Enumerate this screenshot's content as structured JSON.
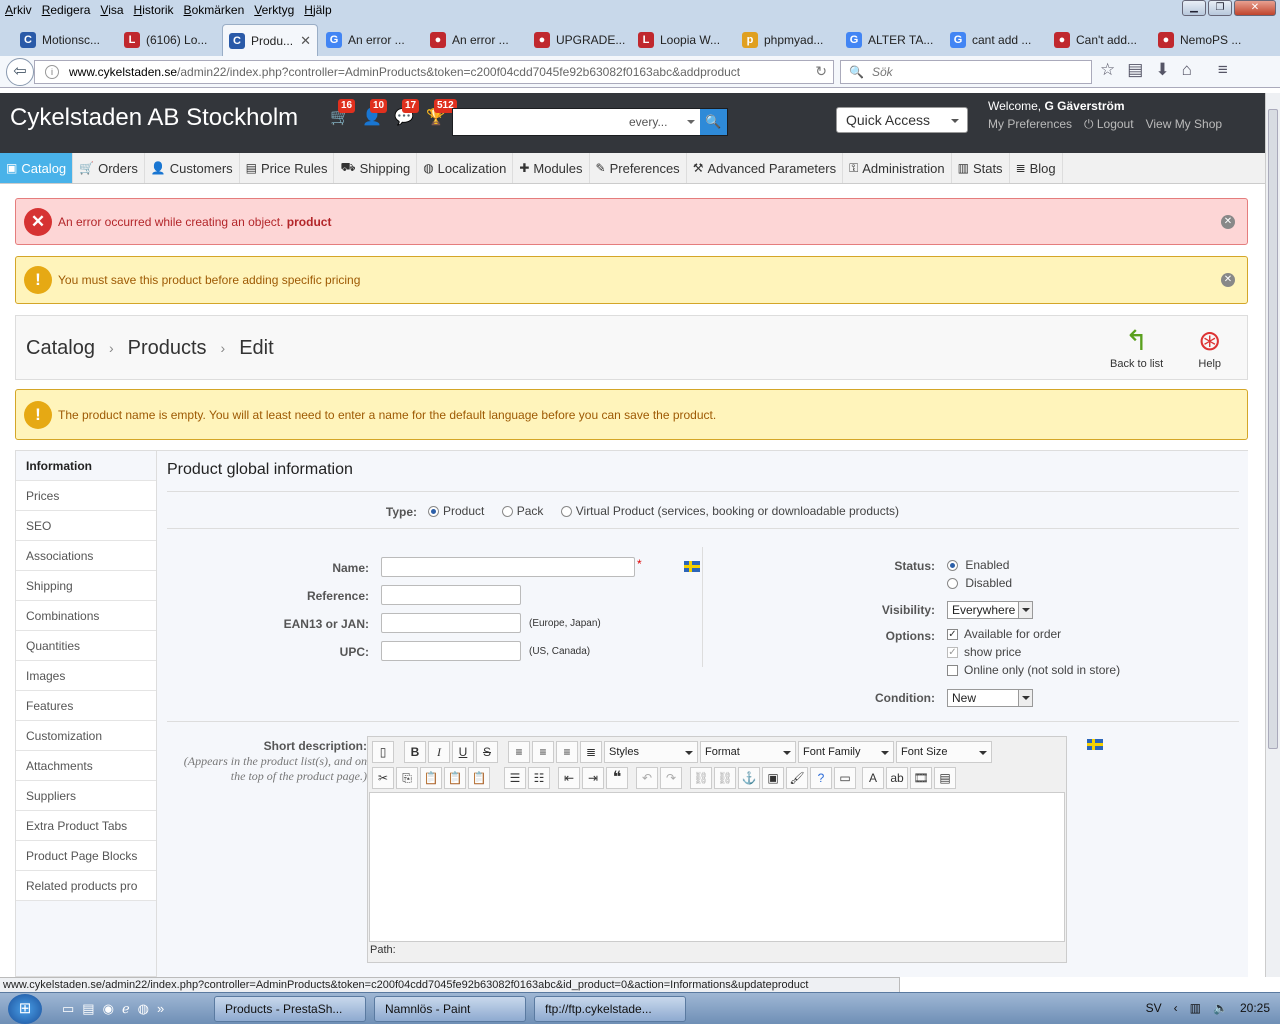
{
  "browser": {
    "menu": [
      "Arkiv",
      "Redigera",
      "Visa",
      "Historik",
      "Bokmärken",
      "Verktyg",
      "Hjälp"
    ],
    "tabs": [
      {
        "label": "Motionsc...",
        "icon": "C",
        "color": "#2a5aa8"
      },
      {
        "label": "(6106) Lo...",
        "icon": "L",
        "color": "#c0282e"
      },
      {
        "label": "Produ...",
        "icon": "C",
        "color": "#2a5aa8",
        "active": true
      },
      {
        "label": "An error ...",
        "icon": "G",
        "color": "#4285f4"
      },
      {
        "label": "An error ...",
        "icon": "●",
        "color": "#c0282e"
      },
      {
        "label": "UPGRADE...",
        "icon": "●",
        "color": "#c0282e"
      },
      {
        "label": "Loopia W...",
        "icon": "L",
        "color": "#c0282e"
      },
      {
        "label": "phpmyad...",
        "icon": "p",
        "color": "#e0a020"
      },
      {
        "label": "ALTER TA...",
        "icon": "G",
        "color": "#4285f4"
      },
      {
        "label": "cant add ...",
        "icon": "G",
        "color": "#4285f4"
      },
      {
        "label": "Can't add...",
        "icon": "●",
        "color": "#c0282e"
      },
      {
        "label": "NemoPS ...",
        "icon": "●",
        "color": "#c0282e"
      }
    ],
    "url_domain": "www.cykelstaden.se",
    "url_path": "/admin22/index.php?controller=AdminProducts&token=c200f04cdd7045fe92b63082f0163abc&addproduct",
    "search_placeholder": "Sök",
    "status_url": "www.cykelstaden.se/admin22/index.php?controller=AdminProducts&token=c200f04cdd7045fe92b63082f0163abc&id_product=0&action=Informations&updateproduct"
  },
  "header": {
    "brand": "Cykelstaden AB Stockholm",
    "badges": {
      "orders": "16",
      "customers": "10",
      "messages": "17",
      "trophy": "512"
    },
    "search_scope": "every...",
    "quick_access": "Quick Access",
    "welcome_prefix": "Welcome, ",
    "welcome_name": "G Gäverström",
    "my_preferences": "My Preferences",
    "logout": "Logout",
    "view_shop": "View My Shop"
  },
  "menu": [
    {
      "label": "Catalog",
      "icon": "▣"
    },
    {
      "label": "Orders",
      "icon": "🛒"
    },
    {
      "label": "Customers",
      "icon": "👤"
    },
    {
      "label": "Price Rules",
      "icon": "▤"
    },
    {
      "label": "Shipping",
      "icon": "⛟"
    },
    {
      "label": "Localization",
      "icon": "◍"
    },
    {
      "label": "Modules",
      "icon": "✚"
    },
    {
      "label": "Preferences",
      "icon": "✎"
    },
    {
      "label": "Advanced Parameters",
      "icon": "⚒"
    },
    {
      "label": "Administration",
      "icon": "⚿"
    },
    {
      "label": "Stats",
      "icon": "▥"
    },
    {
      "label": "Blog",
      "icon": "≣"
    }
  ],
  "alerts": {
    "error_text": "An error occurred while creating an object.",
    "error_bold": "product",
    "warn1": "You must save this product before adding specific pricing",
    "warn2": "The product name is empty. You will at least need to enter a name for the default language before you can save the product."
  },
  "toolbar": {
    "crumbs": [
      "Catalog",
      "Products",
      "Edit"
    ],
    "back": "Back to list",
    "help": "Help"
  },
  "sidetabs": [
    "Information",
    "Prices",
    "SEO",
    "Associations",
    "Shipping",
    "Combinations",
    "Quantities",
    "Images",
    "Features",
    "Customization",
    "Attachments",
    "Suppliers",
    "Extra Product Tabs",
    "Product Page Blocks",
    "Related products pro"
  ],
  "form": {
    "title": "Product global information",
    "type_label": "Type:",
    "type_options": [
      "Product",
      "Pack",
      "Virtual Product (services, booking or downloadable products)"
    ],
    "name_label": "Name:",
    "reference_label": "Reference:",
    "ean_label": "EAN13 or JAN:",
    "ean_hint": "(Europe, Japan)",
    "upc_label": "UPC:",
    "upc_hint": "(US, Canada)",
    "status_label": "Status:",
    "status_enabled": "Enabled",
    "status_disabled": "Disabled",
    "visibility_label": "Visibility:",
    "visibility_value": "Everywhere",
    "options_label": "Options:",
    "opt_available": "Available for order",
    "opt_show_price": "show price",
    "opt_online": "Online only (not sold in store)",
    "condition_label": "Condition:",
    "condition_value": "New",
    "short_desc_label": "Short description:",
    "short_desc_hint": "(Appears in the product list(s), and on the top of the product page.)",
    "editor_styles": "Styles",
    "editor_format": "Format",
    "editor_font_family": "Font Family",
    "editor_font_size": "Font Size",
    "editor_path": "Path:"
  },
  "taskbar": {
    "tasks": [
      "Products - PrestaSh...",
      "Namnlös - Paint",
      "ftp://ftp.cykelstade..."
    ],
    "lang": "SV",
    "time": "20:25"
  }
}
